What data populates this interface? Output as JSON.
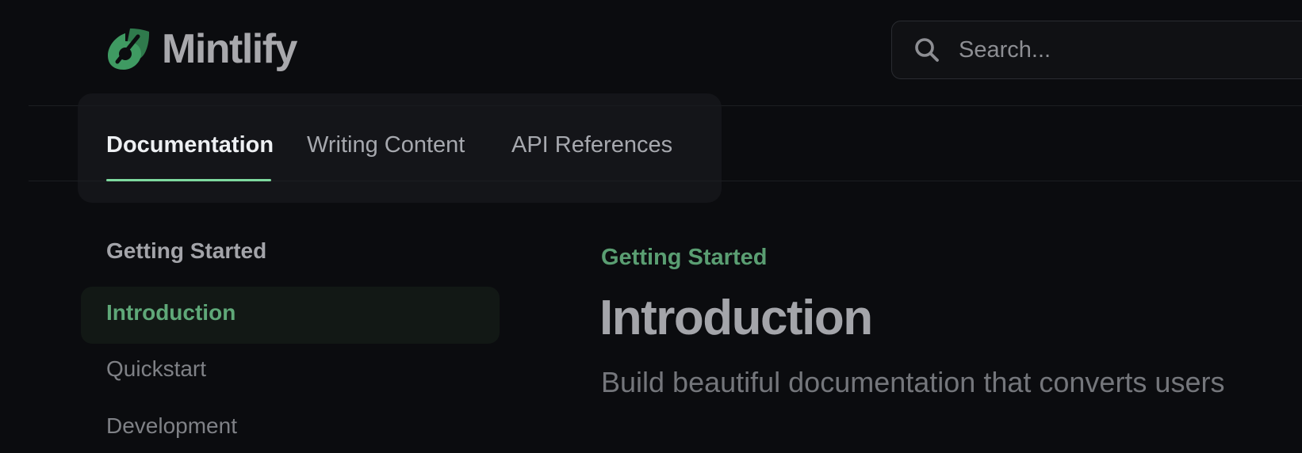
{
  "brand": {
    "name": "Mintlify",
    "logo_icon": "mintlify-leaf-icon",
    "accent_color": "#5fa878",
    "tab_underline_color": "#7ed99f"
  },
  "search": {
    "placeholder": "Search...",
    "icon": "search-icon"
  },
  "tabs": [
    {
      "label": "Documentation",
      "active": true
    },
    {
      "label": "Writing Content",
      "active": false
    },
    {
      "label": "API References",
      "active": false
    }
  ],
  "sidebar": {
    "group_title": "Getting Started",
    "items": [
      {
        "label": "Introduction",
        "active": true
      },
      {
        "label": "Quickstart",
        "active": false
      },
      {
        "label": "Development",
        "active": false
      }
    ]
  },
  "main": {
    "eyebrow": "Getting Started",
    "title": "Introduction",
    "subtitle": "Build beautiful documentation that converts users"
  }
}
